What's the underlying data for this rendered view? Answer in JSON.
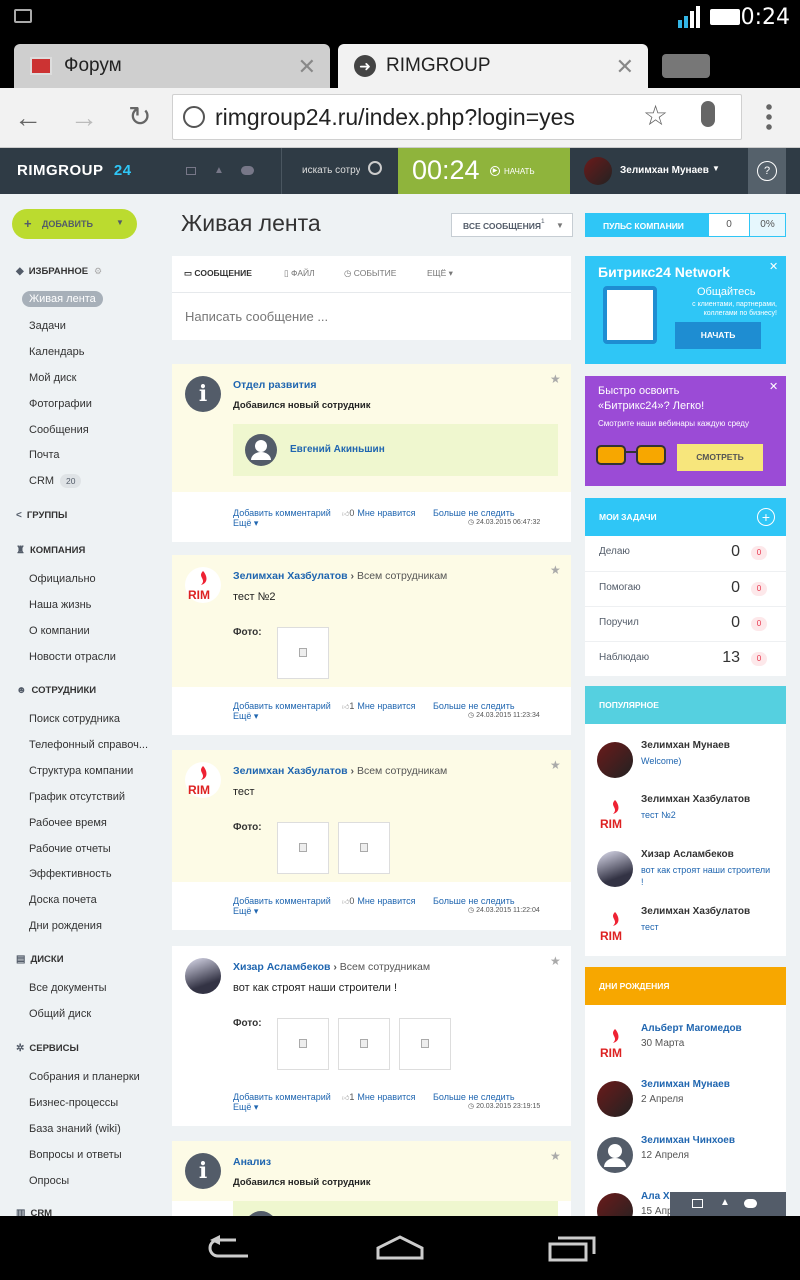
{
  "status": {
    "time": "0:24"
  },
  "tabs": [
    {
      "title": "Форум"
    },
    {
      "title": "RIMGROUP"
    }
  ],
  "url": "rimgroup24.ru/index.php?login=yes",
  "app": {
    "logo": "RIMGROUP",
    "logo_num": "24",
    "search_placeholder": "искать сотрудник",
    "timer": "00:24",
    "start_label": "НАЧАТЬ",
    "user": "Зелимхан Мунаев",
    "help": "?"
  },
  "sidebar": {
    "add_label": "ДОБАВИТЬ",
    "favorites": "ИЗБРАННОЕ",
    "fav_items": [
      "Живая лента",
      "Задачи",
      "Календарь",
      "Мой диск",
      "Фотографии",
      "Сообщения",
      "Почта",
      "CRM"
    ],
    "crm_badge": "20",
    "groups": "ГРУППЫ",
    "company": "КОМПАНИЯ",
    "company_items": [
      "Официально",
      "Наша жизнь",
      "О компании",
      "Новости отрасли"
    ],
    "employees": "СОТРУДНИКИ",
    "employee_items": [
      "Поиск сотрудника",
      "Телефонный справоч...",
      "Структура компании",
      "График отсутствий",
      "Рабочее время",
      "Рабочие отчеты",
      "Эффективность",
      "Доска почета",
      "Дни рождения"
    ],
    "disks": "ДИСКИ",
    "disk_items": [
      "Все документы",
      "Общий диск"
    ],
    "services": "СЕРВИСЫ",
    "service_items": [
      "Собрания и планерки",
      "Бизнес-процессы",
      "База знаний (wiki)",
      "Вопросы и ответы",
      "Опросы"
    ],
    "crm_sec": "CRM"
  },
  "feed": {
    "title": "Живая лента",
    "filter": "ВСЕ СООБЩЕНИЯ",
    "filter_sup": "1",
    "tabs": [
      "СООБЩЕНИЕ",
      "ФАЙЛ",
      "СОБЫТИЕ",
      "ЕЩЁ"
    ],
    "placeholder": "Написать сообщение ...",
    "posts": [
      {
        "author": "Отдел развития",
        "text": "Добавился новый сотрудник",
        "employee": "Евгений Акиньшин",
        "likes": "0",
        "date": "24.03.2015 06:47:32"
      },
      {
        "author": "Зелимхан Хазбулатов",
        "dest": "Всем сотрудникам",
        "text": "тест №2",
        "photo_label": "Фото:",
        "likes": "1",
        "date": "24.03.2015 11:23:34"
      },
      {
        "author": "Зелимхан Хазбулатов",
        "dest": "Всем сотрудникам",
        "text": "тест",
        "photo_label": "Фото:",
        "likes": "0",
        "date": "24.03.2015 11:22:04"
      },
      {
        "author": "Хизар Асламбеков",
        "dest": "Всем сотрудникам",
        "text": "вот как строят наши строители !",
        "photo_label": "Фото:",
        "likes": "1",
        "date": "20.03.2015 23:19:15"
      },
      {
        "author": "Анализ",
        "text": "Добавился новый сотрудник"
      }
    ],
    "actions": {
      "comment": "Добавить комментарий",
      "like": "Мне нравится",
      "unfollow": "Больше не следить",
      "more": "Ещё"
    }
  },
  "right": {
    "pulse_label": "ПУЛЬС КОМПАНИИ",
    "pulse_val": "0",
    "pulse_pct": "0%",
    "network_title": "Битрикс24 Network",
    "network_sub": "Общайтесь",
    "network_text": "с клиентами, партнерами, коллегами по бизнесу!",
    "network_btn": "НАЧАТЬ",
    "webinar_title": "Быстро освоить «Битрикс24»? Легко!",
    "webinar_text": "Смотрите наши вебинары каждую среду",
    "webinar_btn": "СМОТРЕТЬ",
    "tasks_title": "МОИ ЗАДАЧИ",
    "tasks": [
      {
        "label": "Делаю",
        "count": "0",
        "badge": "0"
      },
      {
        "label": "Помогаю",
        "count": "0",
        "badge": "0"
      },
      {
        "label": "Поручил",
        "count": "0",
        "badge": "0"
      },
      {
        "label": "Наблюдаю",
        "count": "13",
        "badge": "0"
      }
    ],
    "popular_title": "ПОПУЛЯРНОЕ",
    "popular": [
      {
        "name": "Зелимхан Мунаев",
        "text": "Welcome)"
      },
      {
        "name": "Зелимхан Хазбулатов",
        "text": "тест №2"
      },
      {
        "name": "Хизар Асламбеков",
        "text": "вот как строят наши строители !"
      },
      {
        "name": "Зелимхан Хазбулатов",
        "text": "тест"
      }
    ],
    "bday_title": "ДНИ РОЖДЕНИЯ",
    "birthdays": [
      {
        "name": "Альберт Магомедов",
        "date": "30 Марта"
      },
      {
        "name": "Зелимхан Мунаев",
        "date": "2 Апреля"
      },
      {
        "name": "Зелимхан Чинхоев",
        "date": "12 Апреля"
      },
      {
        "name": "Ала Ха",
        "date": "15 Апр"
      }
    ]
  },
  "colors": {
    "header": "#2f3b45",
    "green": "#bbdb2f",
    "timer_bg": "#8fb43c",
    "blue": "#2fc6f6",
    "purple": "#9b4bd6",
    "orange": "#f7a700",
    "link": "#2066b0"
  }
}
